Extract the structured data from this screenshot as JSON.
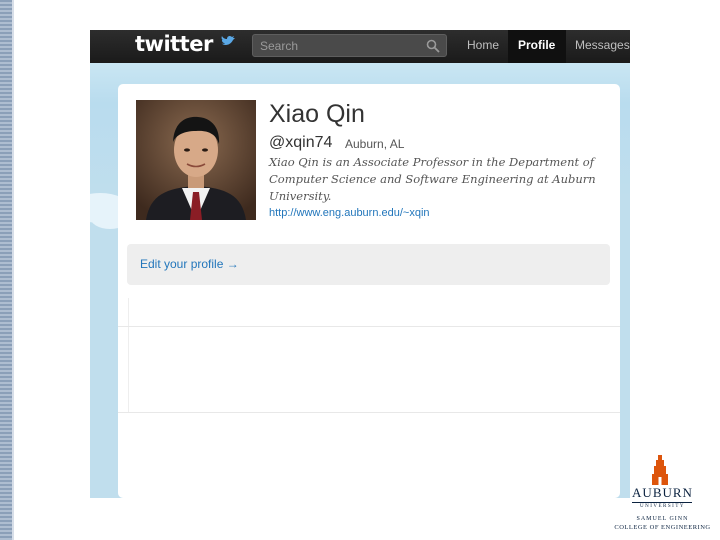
{
  "header": {
    "logo_text": "twitter",
    "search_placeholder": "Search",
    "nav": {
      "home": "Home",
      "profile": "Profile",
      "messages": "Messages"
    }
  },
  "profile": {
    "name": "Xiao Qin",
    "handle": "@xqin74",
    "location": "Auburn, AL",
    "bio": "Xiao Qin is an Associate Professor in the Department of Computer Science and Software Engineering at Auburn University.",
    "url": "http://www.eng.auburn.edu/~xqin",
    "edit_link": "Edit your profile →"
  },
  "branding": {
    "wordmark": "AUBURN",
    "univ": "UNIVERSITY",
    "college_line1": "SAMUEL GINN",
    "college_line2": "COLLEGE OF ENGINEERING"
  },
  "colors": {
    "topbar": "#1a1a1a",
    "sky": "#c0deed",
    "link": "#2276bb",
    "auburn_navy": "#0c2340",
    "auburn_orange": "#dd550c"
  }
}
